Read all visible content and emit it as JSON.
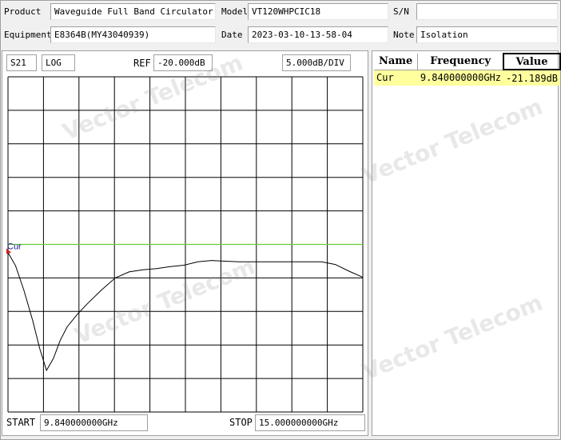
{
  "header": {
    "product_label": "Product",
    "product_value": "Waveguide Full Band Circulator",
    "model_label": "Model",
    "model_value": "VT120WHPCIC18",
    "sn_label": "S/N",
    "sn_value": "",
    "equipment_label": "Equipment",
    "equipment_value": "E8364B(MY43040939)",
    "date_label": "Date",
    "date_value": "2023-03-10-13-58-04",
    "note_label": "Note",
    "note_value": "Isolation"
  },
  "toolbar": {
    "param": "S21",
    "format": "LOG",
    "ref_label": "REF",
    "ref_value": "-20.000dB",
    "scale_value": "5.000dB/DIV"
  },
  "footer": {
    "start_label": "START",
    "start_value": "9.840000000GHz",
    "stop_label": "STOP",
    "stop_value": "15.000000000GHz"
  },
  "marker_table": {
    "headers": [
      "Name",
      "Frequency",
      "Value"
    ],
    "rows": [
      {
        "name": "Cur",
        "frequency": "9.840000000GHz",
        "value": "-21.189dB"
      }
    ]
  },
  "watermark": "Vector Telecom",
  "chart_data": {
    "type": "line",
    "x_unit": "GHz",
    "y_unit": "dB",
    "xlim": [
      9.84,
      15.0
    ],
    "ylim": [
      -45,
      5
    ],
    "grid": true,
    "x_divisions": 10,
    "y_divisions": 10,
    "reference_value": -20.0,
    "reference_label": "Cur",
    "trace_color": "#000000",
    "reference_color": "#66cc33",
    "series": [
      {
        "x": [
          9.84,
          9.95,
          10.07,
          10.2,
          10.3,
          10.4,
          10.5,
          10.6,
          10.7,
          10.85,
          11.0,
          11.2,
          11.4,
          11.6,
          11.8,
          12.0,
          12.2,
          12.4,
          12.6,
          12.8,
          13.0,
          13.2,
          13.4,
          13.6,
          13.8,
          14.0,
          14.2,
          14.4,
          14.6,
          14.8,
          15.0
        ],
        "y": [
          -21.2,
          -23.2,
          -26.8,
          -31.4,
          -35.5,
          -38.8,
          -37.0,
          -34.3,
          -32.3,
          -30.4,
          -28.8,
          -26.8,
          -25.0,
          -24.1,
          -23.8,
          -23.6,
          -23.3,
          -23.1,
          -22.6,
          -22.4,
          -22.5,
          -22.6,
          -22.6,
          -22.6,
          -22.6,
          -22.6,
          -22.6,
          -22.6,
          -23.0,
          -24.0,
          -24.9
        ]
      }
    ]
  }
}
